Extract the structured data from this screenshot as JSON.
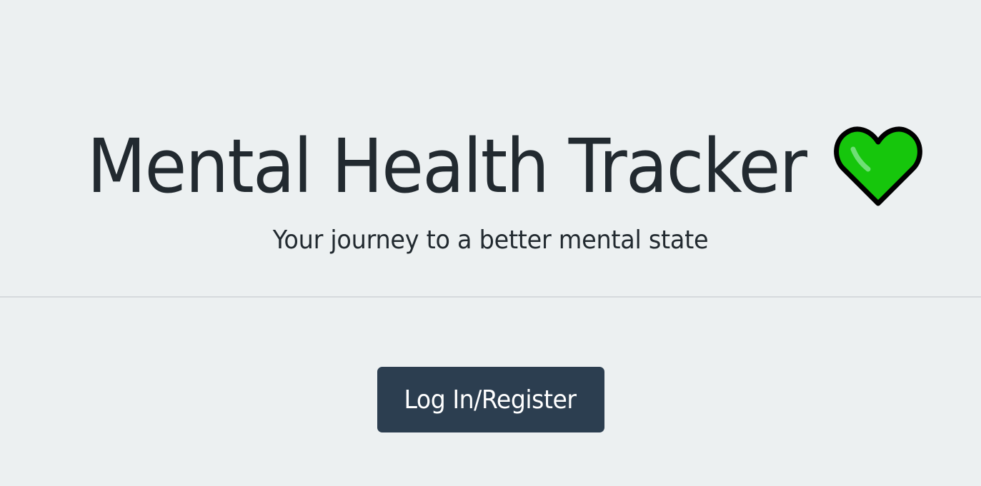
{
  "hero": {
    "title": "Mental Health Tracker",
    "subtitle": "Your journey to a better mental state",
    "title_icon": "green-heart-icon"
  },
  "actions": {
    "login_label": "Log In/Register"
  },
  "colors": {
    "background": "#ecf0f1",
    "text": "#212529",
    "divider": "#d6dadd",
    "button_background": "#2c3e50",
    "button_text": "#ffffff",
    "heart_fill": "#16c60c",
    "heart_outline": "#000000"
  }
}
